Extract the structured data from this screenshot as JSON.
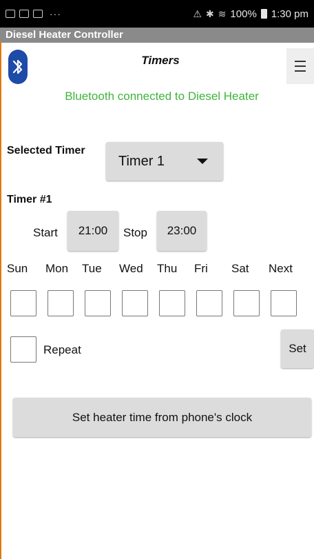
{
  "status_bar": {
    "dots": "···",
    "battery_pct": "100%",
    "time": "1:30 pm"
  },
  "app": {
    "title": "Diesel Heater Controller"
  },
  "header": {
    "page_title": "Timers",
    "bluetooth_status": "Bluetooth connected to Diesel Heater"
  },
  "selected_timer": {
    "label": "Selected Timer",
    "value": "Timer 1"
  },
  "timer": {
    "heading": "Timer #1",
    "start_label": "Start",
    "start_time": "21:00",
    "stop_label": "Stop",
    "stop_time": "23:00"
  },
  "days": [
    "Sun",
    "Mon",
    "Tue",
    "Wed",
    "Thu",
    "Fri",
    "Sat",
    "Next"
  ],
  "repeat_label": "Repeat",
  "set_label": "Set",
  "sync_button_label": "Set heater time from phone's clock",
  "colors": {
    "status_green": "#3fb43a",
    "bluetooth_blue": "#1e4aa8",
    "edge_orange": "#e07a10",
    "titlebar_gray": "#8a8a8a"
  },
  "icons": {
    "bluetooth": "bluetooth-icon",
    "menu": "hamburger-menu-icon",
    "dropdown": "caret-down-icon"
  }
}
